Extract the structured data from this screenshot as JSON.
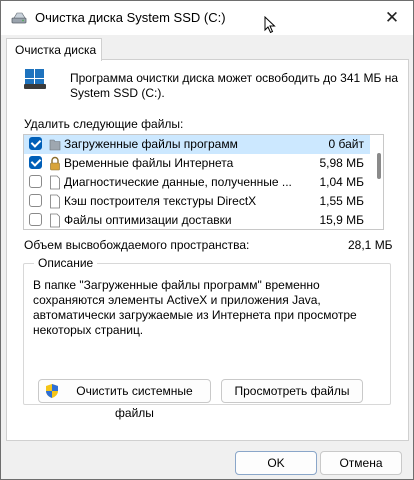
{
  "window": {
    "title": "Очистка диска System SSD (C:)",
    "close_glyph": "✕"
  },
  "tab": {
    "label": "Очистка диска"
  },
  "intro": {
    "text": "Программа очистки диска может освободить до 341 МБ на System SSD (C:)."
  },
  "files": {
    "label": "Удалить следующие файлы:",
    "items": [
      {
        "name": "Загруженные файлы программ",
        "size": "0 байт",
        "checked": true,
        "selected": true,
        "icon": "folder-icon"
      },
      {
        "name": "Временные файлы Интернета",
        "size": "5,98 МБ",
        "checked": true,
        "selected": false,
        "icon": "lock-icon"
      },
      {
        "name": "Диагностические данные, полученные ...",
        "size": "1,04 МБ",
        "checked": false,
        "selected": false,
        "icon": "file-icon"
      },
      {
        "name": "Кэш построителя текстуры DirectX",
        "size": "1,55 МБ",
        "checked": false,
        "selected": false,
        "icon": "file-icon"
      },
      {
        "name": "Файлы оптимизации доставки",
        "size": "15,9 МБ",
        "checked": false,
        "selected": false,
        "icon": "file-icon"
      }
    ]
  },
  "space": {
    "label": "Объем высвобождаемого пространства:",
    "value": "28,1 МБ"
  },
  "description": {
    "title": "Описание",
    "text": "В папке \"Загруженные файлы программ\" временно сохраняются элементы ActiveX и приложения Java, автоматически загружаемые из Интернета при просмотре некоторых страниц."
  },
  "buttons": {
    "clean_system": "Очистить системные файлы",
    "view_files": "Просмотреть файлы",
    "ok": "OK",
    "cancel": "Отмена"
  },
  "colors": {
    "accent": "#005fb8",
    "selection": "#cce8ff"
  }
}
